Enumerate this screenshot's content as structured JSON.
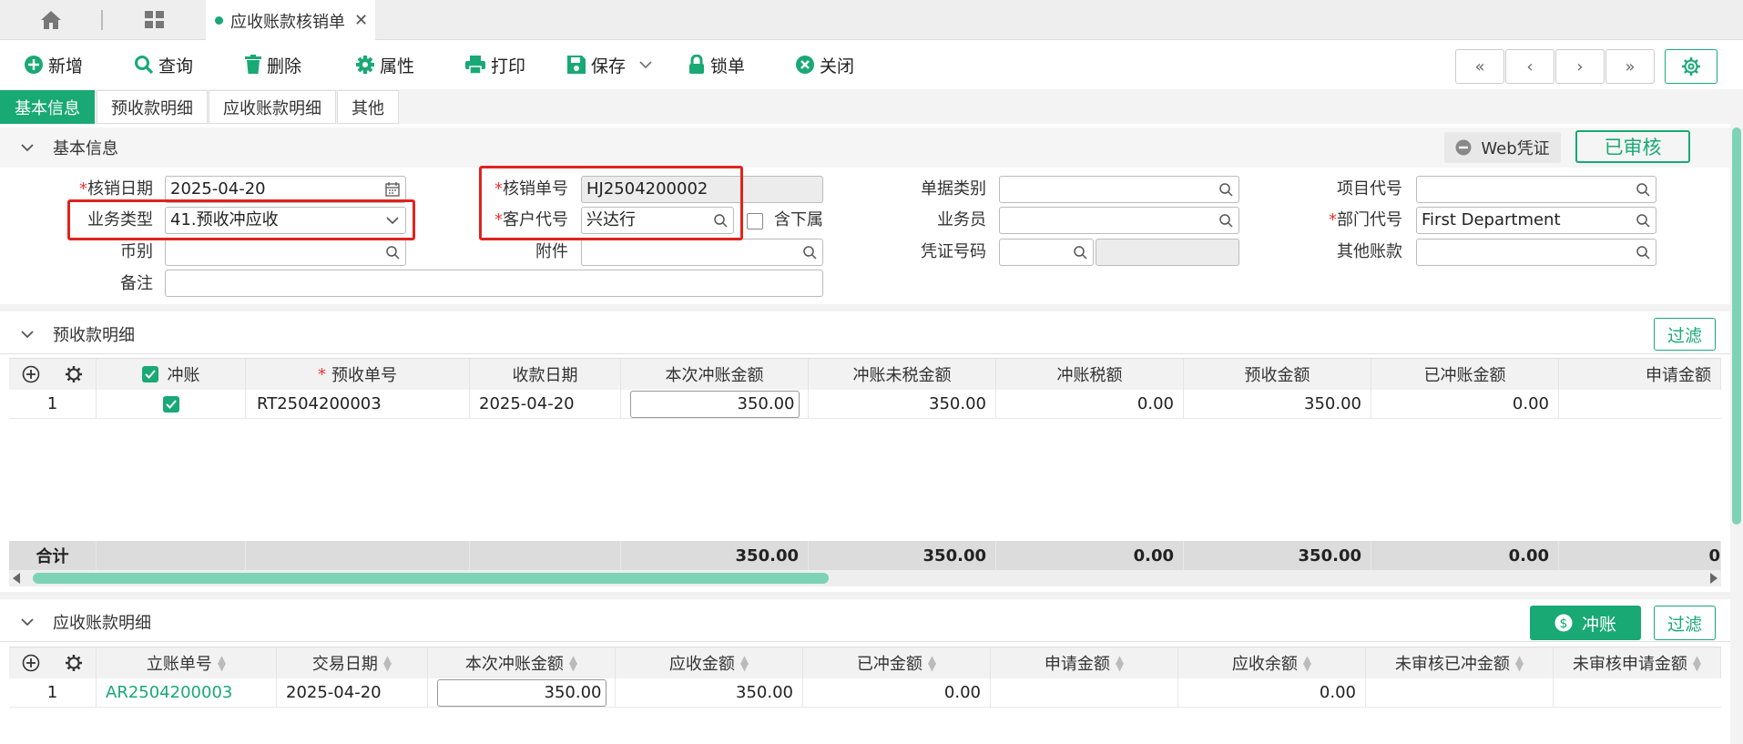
{
  "tab": {
    "title": "应收账款核销单",
    "close": "✕"
  },
  "toolbar": {
    "new": "新增",
    "query": "查询",
    "delete": "删除",
    "props": "属性",
    "print": "打印",
    "save": "保存",
    "lock": "锁单",
    "close": "关闭"
  },
  "subtabs": [
    "基本信息",
    "预收款明细",
    "应收账款明细",
    "其他"
  ],
  "basic": {
    "section_title": "基本信息",
    "web_voucher": "Web凭证",
    "status": "已审核",
    "labels": {
      "date": "核销日期",
      "type": "业务类型",
      "currency": "币别",
      "remark": "备注",
      "doc_no": "核销单号",
      "customer": "客户代号",
      "attach": "附件",
      "sub": "含下属",
      "doc_type": "单据类别",
      "salesman": "业务员",
      "voucher_no": "凭证号码",
      "project": "项目代号",
      "dept": "部门代号",
      "other_acc": "其他账款"
    },
    "values": {
      "date": "2025-04-20",
      "type": "41.预收冲应收",
      "doc_no": "HJ2504200002",
      "customer": "兴达行",
      "dept": "First Department"
    }
  },
  "prepay": {
    "section_title": "预收款明细",
    "filter": "过滤",
    "headers": [
      "冲账",
      "预收单号",
      "收款日期",
      "本次冲账金额",
      "冲账未税金额",
      "冲账税额",
      "预收金额",
      "已冲账金额",
      "申请金额"
    ],
    "rows": [
      {
        "idx": "1",
        "no": "RT2504200003",
        "date": "2025-04-20",
        "amount": "350.00",
        "untaxed": "350.00",
        "tax": "0.00",
        "prepaid": "350.00",
        "written": "0.00"
      }
    ],
    "total": {
      "label": "合计",
      "amount": "350.00",
      "untaxed": "350.00",
      "tax": "0.00",
      "prepaid": "350.00",
      "written": "0.00",
      "apply": "0"
    }
  },
  "receivable": {
    "section_title": "应收账款明细",
    "writeoff": "冲账",
    "filter": "过滤",
    "headers": [
      "立账单号",
      "交易日期",
      "本次冲账金额",
      "应收金额",
      "已冲金额",
      "申请金额",
      "应收余额",
      "未审核已冲金额",
      "未审核申请金额"
    ],
    "rows": [
      {
        "idx": "1",
        "no": "AR2504200003",
        "date": "2025-04-20",
        "amount": "350.00",
        "receivable": "350.00",
        "written": "0.00",
        "apply": "",
        "balance": "0.00"
      }
    ]
  },
  "colors": {
    "accent": "#19a974",
    "highlight": "#e0231e"
  }
}
